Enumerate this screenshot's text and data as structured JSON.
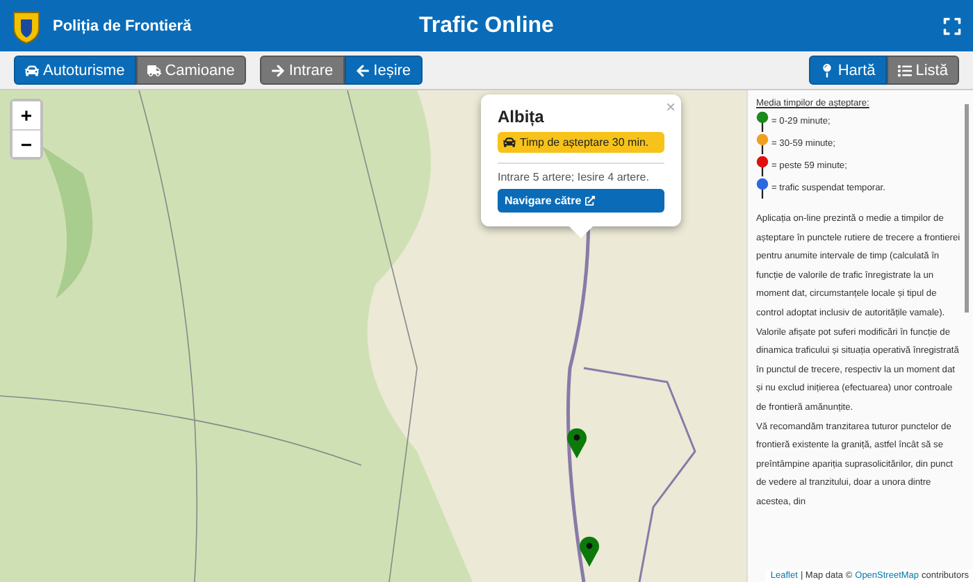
{
  "header": {
    "brand": "Poliția de Frontieră",
    "title": "Trafic Online"
  },
  "toolbar": {
    "vehicle": [
      {
        "label": "Autoturisme",
        "selected": true
      },
      {
        "label": "Camioane",
        "selected": false
      }
    ],
    "direction": [
      {
        "label": "Intrare",
        "selected": false
      },
      {
        "label": "Ieșire",
        "selected": true
      }
    ],
    "view": [
      {
        "label": "Hartă",
        "selected": true
      },
      {
        "label": "Listă",
        "selected": false
      }
    ]
  },
  "map": {
    "zoom": [
      "+",
      "−"
    ],
    "popup": {
      "title": "Albița",
      "wait": "Timp de așteptare 30 min.",
      "info": "Intrare 5 artere; Iesire 4 artere.",
      "button": "Navigare către",
      "close": "×"
    },
    "markers": [
      {
        "color": "#0b7a0b"
      },
      {
        "color": "#0b7a0b"
      }
    ],
    "attribution": {
      "leaflet": "Leaflet",
      "text": "| Map data ©",
      "osm": "OpenStreetMap",
      "rest": "contributors"
    }
  },
  "panel": {
    "legend_title": "Media timpilor de așteptare:",
    "legend": [
      {
        "color": "#1a8a1a",
        "text": "= 0-29 minute;"
      },
      {
        "color": "#f0a020",
        "text": "= 30-59 minute;"
      },
      {
        "color": "#e01010",
        "text": "= peste 59 minute;"
      },
      {
        "color": "#2a6ae0",
        "text": "= trafic suspendat temporar."
      }
    ],
    "paragraphs": [
      "Aplicația on-line prezintă o medie a timpilor de așteptare în punctele rutiere de trecere a frontierei pentru anumite intervale de timp (calculată în funcție de valorile de trafic înregistrate la un moment dat, circumstanțele locale și tipul de control adoptat inclusiv de autoritățile vamale). Valorile afișate pot suferi modificări în funcție de dinamica traficului și situația operativă înregistrată în punctul de trecere, respectiv la un moment dat și nu exclud inițierea (efectuarea) unor controale de frontieră amănunțite.",
      "Vă recomandăm tranzitarea tuturor punctelor de frontieră existente la graniță, astfel încât să se preîntâmpine apariția suprasolicitărilor, din punct de vedere al tranzitului, doar a unora dintre acestea, din"
    ]
  }
}
